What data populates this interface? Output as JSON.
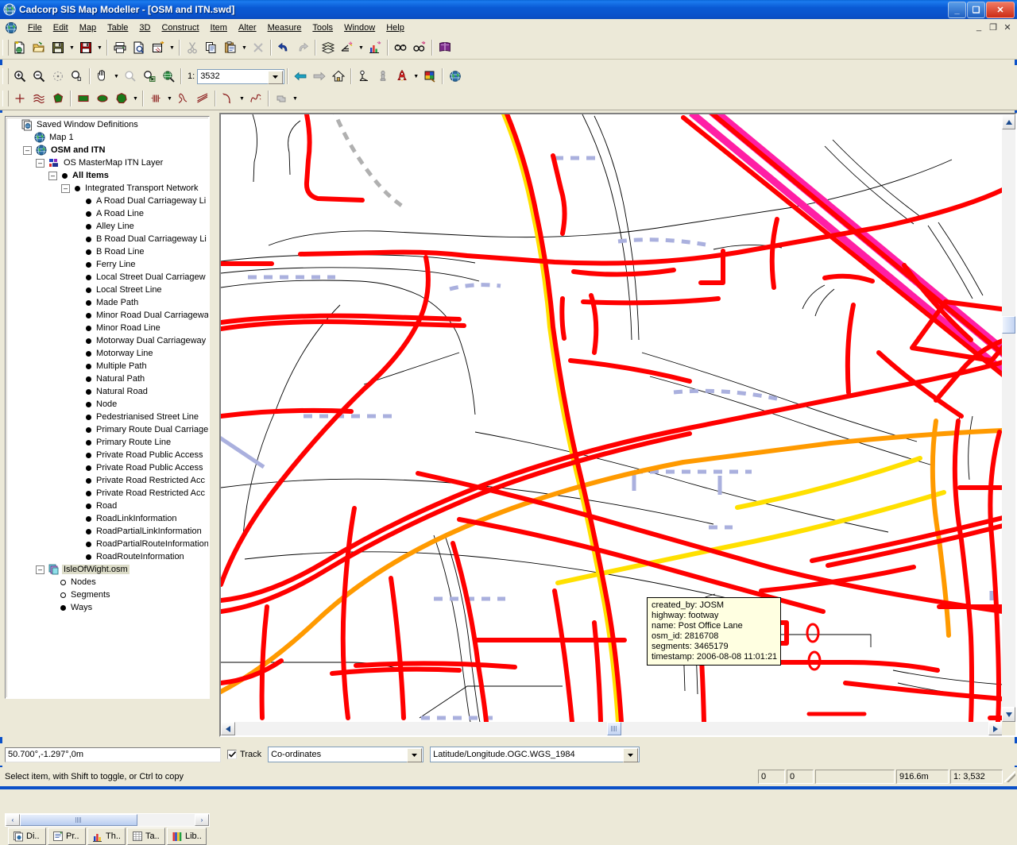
{
  "window": {
    "title": "Cadcorp SIS Map Modeller  - [OSM and ITN.swd]",
    "icon": "globe-icon",
    "minimize_label": "_",
    "maximize_label": "❑",
    "close_label": "✕",
    "mdi_minimize": "_",
    "mdi_restore": "❐",
    "mdi_close": "✕"
  },
  "menubar": {
    "items": [
      {
        "label": "File"
      },
      {
        "label": "Edit"
      },
      {
        "label": "Map"
      },
      {
        "label": "Table"
      },
      {
        "label": "3D"
      },
      {
        "label": "Construct"
      },
      {
        "label": "Item"
      },
      {
        "label": "Alter"
      },
      {
        "label": "Measure"
      },
      {
        "label": "Tools"
      },
      {
        "label": "Window"
      },
      {
        "label": "Help"
      }
    ]
  },
  "toolbar_standard": {
    "buttons": [
      "new-document-icon",
      "open-folder-icon",
      "save-icon",
      "save-all-icon",
      "print-icon",
      "print-preview-icon",
      "print-layout-icon",
      "cut-icon",
      "copy-icon",
      "paste-icon",
      "delete-icon",
      "undo-icon",
      "redo-icon",
      "overlays-icon",
      "overlay-add-icon",
      "chart-overlay-icon",
      "find-icon",
      "find-next-icon",
      "help-book-icon"
    ]
  },
  "toolbar_view": {
    "buttons": [
      "zoom-in-icon",
      "zoom-out-icon",
      "zoom-point-icon",
      "zoom-pan-icon",
      "pan-hand-icon",
      "zoom-selected-icon",
      "zoom-window-icon",
      "zoom-world-icon"
    ],
    "scale_prefix": "1:",
    "scale_value": "3532",
    "nav_buttons": [
      "back-arrow-icon",
      "forward-arrow-icon",
      "home-icon",
      "view-from-icon",
      "view-to-icon",
      "rocket-icon",
      "palette-icon",
      "globe-icon"
    ]
  },
  "toolbar_draw": {
    "buttons": [
      "point-icon",
      "polyline-icon",
      "polygon-icon",
      "rectangle-icon",
      "ellipse-icon",
      "filled-polygon-icon",
      "hatch-icon",
      "freehand-icon",
      "parallel-lines-icon",
      "arc-icon",
      "spline-icon",
      "text-block-icon"
    ]
  },
  "tree": {
    "title": "Saved Window Definitions",
    "nodes": [
      {
        "label": "Saved Window Definitions",
        "indent": 0,
        "icon": "windows-definitions-icon",
        "marker": "none",
        "bold": false,
        "expander": "none",
        "selected": false
      },
      {
        "label": "Map 1",
        "indent": 1,
        "icon": "globe-icon",
        "marker": "none",
        "bold": false,
        "expander": "none",
        "selected": false
      },
      {
        "label": "OSM and ITN",
        "indent": 1,
        "icon": "globe-icon",
        "marker": "none",
        "bold": true,
        "expander": "minus",
        "selected": false
      },
      {
        "label": "OS MasterMap ITN Layer",
        "indent": 2,
        "icon": "itn-layer-icon",
        "marker": "none",
        "bold": false,
        "expander": "minus",
        "selected": false
      },
      {
        "label": "All Items",
        "indent": 3,
        "icon": "none",
        "marker": "filled",
        "bold": true,
        "expander": "minus",
        "selected": false
      },
      {
        "label": "Integrated Transport Network",
        "indent": 4,
        "icon": "none",
        "marker": "filled",
        "bold": false,
        "expander": "minus",
        "selected": false
      },
      {
        "label": "A Road Dual Carriageway Li",
        "indent": 5,
        "icon": "none",
        "marker": "filled",
        "bold": false,
        "expander": "none",
        "selected": false
      },
      {
        "label": "A Road Line",
        "indent": 5,
        "icon": "none",
        "marker": "filled",
        "bold": false,
        "expander": "none",
        "selected": false
      },
      {
        "label": "Alley Line",
        "indent": 5,
        "icon": "none",
        "marker": "filled",
        "bold": false,
        "expander": "none",
        "selected": false
      },
      {
        "label": "B Road Dual Carriageway Li",
        "indent": 5,
        "icon": "none",
        "marker": "filled",
        "bold": false,
        "expander": "none",
        "selected": false
      },
      {
        "label": "B Road Line",
        "indent": 5,
        "icon": "none",
        "marker": "filled",
        "bold": false,
        "expander": "none",
        "selected": false
      },
      {
        "label": "Ferry Line",
        "indent": 5,
        "icon": "none",
        "marker": "filled",
        "bold": false,
        "expander": "none",
        "selected": false
      },
      {
        "label": "Local Street Dual Carriagew",
        "indent": 5,
        "icon": "none",
        "marker": "filled",
        "bold": false,
        "expander": "none",
        "selected": false
      },
      {
        "label": "Local Street Line",
        "indent": 5,
        "icon": "none",
        "marker": "filled",
        "bold": false,
        "expander": "none",
        "selected": false
      },
      {
        "label": "Made Path",
        "indent": 5,
        "icon": "none",
        "marker": "filled",
        "bold": false,
        "expander": "none",
        "selected": false
      },
      {
        "label": "Minor Road Dual Carriagewa",
        "indent": 5,
        "icon": "none",
        "marker": "filled",
        "bold": false,
        "expander": "none",
        "selected": false
      },
      {
        "label": "Minor Road Line",
        "indent": 5,
        "icon": "none",
        "marker": "filled",
        "bold": false,
        "expander": "none",
        "selected": false
      },
      {
        "label": "Motorway Dual Carriageway",
        "indent": 5,
        "icon": "none",
        "marker": "filled",
        "bold": false,
        "expander": "none",
        "selected": false
      },
      {
        "label": "Motorway Line",
        "indent": 5,
        "icon": "none",
        "marker": "filled",
        "bold": false,
        "expander": "none",
        "selected": false
      },
      {
        "label": "Multiple Path",
        "indent": 5,
        "icon": "none",
        "marker": "filled",
        "bold": false,
        "expander": "none",
        "selected": false
      },
      {
        "label": "Natural Path",
        "indent": 5,
        "icon": "none",
        "marker": "filled",
        "bold": false,
        "expander": "none",
        "selected": false
      },
      {
        "label": "Natural Road",
        "indent": 5,
        "icon": "none",
        "marker": "filled",
        "bold": false,
        "expander": "none",
        "selected": false
      },
      {
        "label": "Node",
        "indent": 5,
        "icon": "none",
        "marker": "filled",
        "bold": false,
        "expander": "none",
        "selected": false
      },
      {
        "label": "Pedestrianised Street Line",
        "indent": 5,
        "icon": "none",
        "marker": "filled",
        "bold": false,
        "expander": "none",
        "selected": false
      },
      {
        "label": "Primary Route Dual Carriage",
        "indent": 5,
        "icon": "none",
        "marker": "filled",
        "bold": false,
        "expander": "none",
        "selected": false
      },
      {
        "label": "Primary Route Line",
        "indent": 5,
        "icon": "none",
        "marker": "filled",
        "bold": false,
        "expander": "none",
        "selected": false
      },
      {
        "label": "Private Road Public Access",
        "indent": 5,
        "icon": "none",
        "marker": "filled",
        "bold": false,
        "expander": "none",
        "selected": false
      },
      {
        "label": "Private Road Public Access",
        "indent": 5,
        "icon": "none",
        "marker": "filled",
        "bold": false,
        "expander": "none",
        "selected": false
      },
      {
        "label": "Private Road Restricted Acc",
        "indent": 5,
        "icon": "none",
        "marker": "filled",
        "bold": false,
        "expander": "none",
        "selected": false
      },
      {
        "label": "Private Road Restricted Acc",
        "indent": 5,
        "icon": "none",
        "marker": "filled",
        "bold": false,
        "expander": "none",
        "selected": false
      },
      {
        "label": "Road",
        "indent": 5,
        "icon": "none",
        "marker": "filled",
        "bold": false,
        "expander": "none",
        "selected": false
      },
      {
        "label": "RoadLinkInformation",
        "indent": 5,
        "icon": "none",
        "marker": "filled",
        "bold": false,
        "expander": "none",
        "selected": false
      },
      {
        "label": "RoadPartialLinkInformation",
        "indent": 5,
        "icon": "none",
        "marker": "filled",
        "bold": false,
        "expander": "none",
        "selected": false
      },
      {
        "label": "RoadPartialRouteInformation",
        "indent": 5,
        "icon": "none",
        "marker": "filled",
        "bold": false,
        "expander": "none",
        "selected": false
      },
      {
        "label": "RoadRouteInformation",
        "indent": 5,
        "icon": "none",
        "marker": "filled",
        "bold": false,
        "expander": "none",
        "selected": false
      },
      {
        "label": "IsleOfWight.osm",
        "indent": 2,
        "icon": "osm-dataset-icon",
        "marker": "none",
        "bold": false,
        "expander": "minus",
        "selected": true
      },
      {
        "label": "Nodes",
        "indent": 3,
        "icon": "none",
        "marker": "hollow",
        "bold": false,
        "expander": "none",
        "selected": false
      },
      {
        "label": "Segments",
        "indent": 3,
        "icon": "none",
        "marker": "hollow",
        "bold": false,
        "expander": "none",
        "selected": false
      },
      {
        "label": "Ways",
        "indent": 3,
        "icon": "none",
        "marker": "filled",
        "bold": false,
        "expander": "none",
        "selected": false
      }
    ]
  },
  "panel_tabs": [
    {
      "label": "Di..",
      "icon": "display-icon"
    },
    {
      "label": "Pr..",
      "icon": "properties-icon"
    },
    {
      "label": "Th..",
      "icon": "thematic-icon"
    },
    {
      "label": "Ta..",
      "icon": "table-icon"
    },
    {
      "label": "Lib..",
      "icon": "library-icon"
    }
  ],
  "tooltip": {
    "lines": [
      "created_by: JOSM",
      "highway: footway",
      "name: Post Office Lane",
      "osm_id: 2816708",
      "segments: 3465179",
      "timestamp: 2006-08-08 11:01:21"
    ]
  },
  "coordbar": {
    "coordinates": "50.700°,-1.297°,0m",
    "track_checked": true,
    "track_label": "Track",
    "coord_mode": "Co-ordinates",
    "projection": "Latitude/Longitude.OGC.WGS_1984"
  },
  "statusbar": {
    "message": "Select item, with Shift to toggle, or Ctrl to copy",
    "cell1": "0",
    "cell2": "0",
    "cell3": "",
    "distance": "916.6m",
    "scale": "1: 3,532"
  },
  "scrollbars": {
    "left_arrow": "‹",
    "right_arrow": "›",
    "up_arrow": "▲",
    "down_arrow": "▼"
  },
  "colors": {
    "road_red": "#FF0000",
    "road_yellow": "#FFFF00",
    "road_orange": "#FF9900",
    "railway_magenta": "#FF20A0",
    "building_outline": "#000000",
    "footpath_blue": "#B0B8E8",
    "path_grey": "#AAAAAA",
    "titlebar_blue": "#0a50c8",
    "chrome": "#ece9d8"
  }
}
